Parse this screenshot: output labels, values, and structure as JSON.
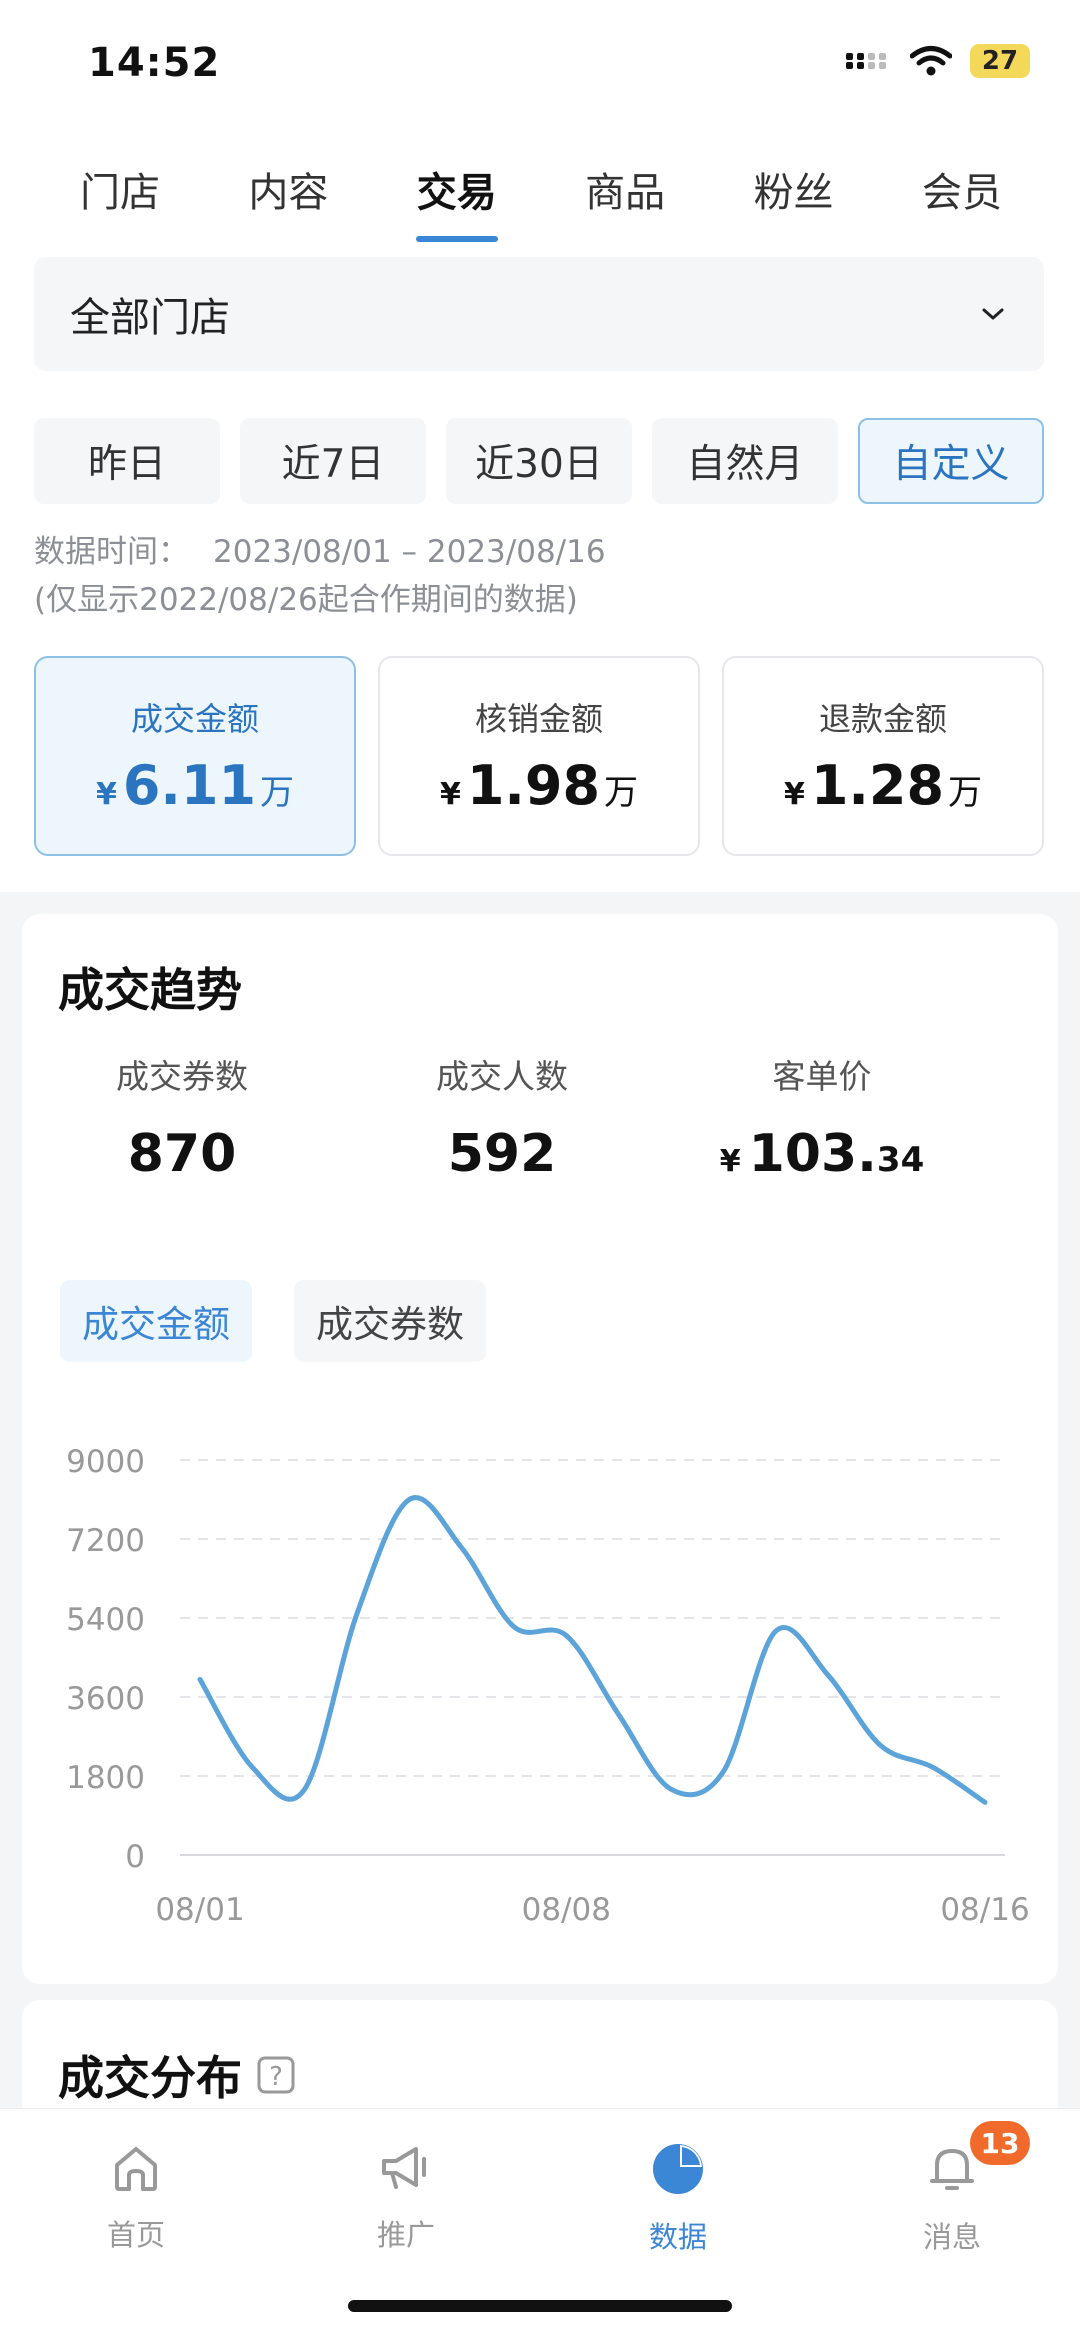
{
  "status_bar": {
    "time": "14:52",
    "battery": "27"
  },
  "tabs": [
    {
      "label": "门店"
    },
    {
      "label": "内容"
    },
    {
      "label": "交易",
      "active": true
    },
    {
      "label": "商品"
    },
    {
      "label": "粉丝"
    },
    {
      "label": "会员"
    }
  ],
  "store_selector": {
    "value": "全部门店"
  },
  "date_tabs": [
    {
      "label": "昨日"
    },
    {
      "label": "近7日"
    },
    {
      "label": "近30日"
    },
    {
      "label": "自然月"
    },
    {
      "label": "自定义",
      "active": true
    }
  ],
  "data_time": {
    "label": "数据时间：",
    "range": "2023/08/01 – 2023/08/16",
    "note": "(仅显示2022/08/26起合作期间的数据)"
  },
  "metric_cards": [
    {
      "label": "成交金额",
      "currency": "¥",
      "value": "6.11",
      "unit": "万",
      "active": true
    },
    {
      "label": "核销金额",
      "currency": "¥",
      "value": "1.98",
      "unit": "万"
    },
    {
      "label": "退款金额",
      "currency": "¥",
      "value": "1.28",
      "unit": "万"
    }
  ],
  "trend": {
    "title": "成交趋势",
    "stats": [
      {
        "label": "成交券数",
        "value": "870"
      },
      {
        "label": "成交人数",
        "value": "592"
      },
      {
        "label": "客单价",
        "currency": "¥",
        "value_int": "103.",
        "value_dec": "34"
      }
    ],
    "chips": [
      {
        "label": "成交金额",
        "active": true
      },
      {
        "label": "成交券数"
      }
    ]
  },
  "chart_data": {
    "type": "line",
    "x": [
      "08/01",
      "08/02",
      "08/03",
      "08/04",
      "08/05",
      "08/06",
      "08/07",
      "08/08",
      "08/09",
      "08/10",
      "08/11",
      "08/12",
      "08/13",
      "08/14",
      "08/15",
      "08/16"
    ],
    "x_tick_labels": [
      "08/01",
      "08/08",
      "08/16"
    ],
    "y_ticks": [
      0,
      1800,
      3600,
      5400,
      7200,
      9000
    ],
    "ylim": [
      0,
      9000
    ],
    "series": [
      {
        "values": [
          4000,
          2000,
          1500,
          5500,
          8100,
          7000,
          5200,
          5000,
          3200,
          1500,
          1900,
          5100,
          4100,
          2500,
          2000,
          1200
        ],
        "color": "#5ba3d9"
      }
    ],
    "grid": true
  },
  "distribution": {
    "title": "成交分布",
    "help_icon": "question-icon"
  },
  "bottom_nav": [
    {
      "label": "首页",
      "icon": "home-icon"
    },
    {
      "label": "推广",
      "icon": "megaphone-icon"
    },
    {
      "label": "数据",
      "icon": "pie-chart-icon",
      "active": true
    },
    {
      "label": "消息",
      "icon": "bell-icon",
      "badge": "13"
    }
  ]
}
